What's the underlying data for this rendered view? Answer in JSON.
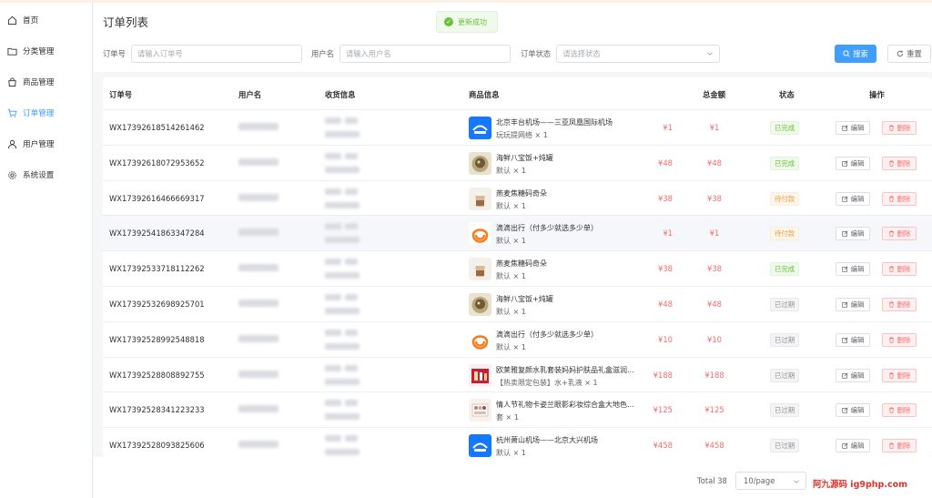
{
  "sidebar": {
    "items": [
      {
        "label": "首页",
        "icon": "home-icon",
        "active": false
      },
      {
        "label": "分类管理",
        "icon": "folder-icon",
        "active": false
      },
      {
        "label": "商品管理",
        "icon": "bag-icon",
        "active": false
      },
      {
        "label": "订单管理",
        "icon": "cart-icon",
        "active": true
      },
      {
        "label": "用户管理",
        "icon": "user-icon",
        "active": false
      },
      {
        "label": "系统设置",
        "icon": "gear-icon",
        "active": false
      }
    ]
  },
  "page": {
    "title": "订单列表"
  },
  "toast": {
    "message": "更新成功",
    "color": "#67c23a"
  },
  "filters": {
    "order_label": "订单号",
    "order_placeholder": "请输入订单号",
    "user_label": "用户名",
    "user_placeholder": "请输入用户名",
    "status_label": "订单状态",
    "status_placeholder": "请选择状态",
    "search_label": "搜索",
    "reset_label": "重置"
  },
  "table": {
    "headers": {
      "order": "订单号",
      "user": "用户名",
      "address": "收货信息",
      "product": "商品信息",
      "total": "总金额",
      "status": "状态",
      "action": "操作"
    },
    "edit_label": "编辑",
    "delete_label": "删除",
    "rows": [
      {
        "order": "WX17392618514261462",
        "product": "北京丰台机场——三亚凤凰国际机场",
        "qty": "玩玩提网络 × 1",
        "thumb": "blue-app",
        "unit": "¥1",
        "total": "¥1",
        "status": "已完成",
        "status_type": "done"
      },
      {
        "order": "WX17392618072953652",
        "product": "海鲜八宝饭+炖罐",
        "qty": "默认 × 1",
        "thumb": "food",
        "unit": "¥48",
        "total": "¥48",
        "status": "已完成",
        "status_type": "done"
      },
      {
        "order": "WX17392616466669317",
        "product": "燕麦焦糖码奇朵",
        "qty": "默认 × 1",
        "thumb": "coffee",
        "unit": "¥38",
        "total": "¥38",
        "status": "待付款",
        "status_type": "wait"
      },
      {
        "order": "WX17392541863347284",
        "product": "滴滴出行（付多少就选多少单）",
        "qty": "默认 × 1",
        "thumb": "didi",
        "unit": "¥1",
        "total": "¥1",
        "status": "待付款",
        "status_type": "wait"
      },
      {
        "order": "WX17392533718112262",
        "product": "燕麦焦糖码奇朵",
        "qty": "默认 × 1",
        "thumb": "coffee",
        "unit": "¥38",
        "total": "¥38",
        "status": "已完成",
        "status_type": "done"
      },
      {
        "order": "WX17392532698925701",
        "product": "海鲜八宝饭+炖罐",
        "qty": "默认 × 1",
        "thumb": "food",
        "unit": "¥48",
        "total": "¥48",
        "status": "已过期",
        "status_type": "exp"
      },
      {
        "order": "WX17392528992548818",
        "product": "滴滴出行（付多少就选多少单）",
        "qty": "默认 × 1",
        "thumb": "didi",
        "unit": "¥10",
        "total": "¥10",
        "status": "已过期",
        "status_type": "exp"
      },
      {
        "order": "WX17392528808892755",
        "product": "欧莱雅复颜水乳套装妈妈护肤品礼盒滋润...",
        "qty": "【热卖限定包装】水+乳液 × 1",
        "thumb": "cosmetic",
        "unit": "¥188",
        "total": "¥188",
        "status": "已过期",
        "status_type": "exp"
      },
      {
        "order": "WX17392528341223233",
        "product": "情人节礼物卡姿兰眼影彩妆综合盒大地色...",
        "qty": "套 × 1",
        "thumb": "makeup",
        "unit": "¥125",
        "total": "¥125",
        "status": "已过期",
        "status_type": "exp"
      },
      {
        "order": "WX17392528093825606",
        "product": "杭州萧山机场——北京大兴机场",
        "qty": "默认 × 1",
        "thumb": "blue-app",
        "unit": "¥458",
        "total": "¥458",
        "status": "已过期",
        "status_type": "exp"
      }
    ]
  },
  "pagination": {
    "total_text": "Total 38",
    "page_size": "10/page"
  },
  "watermark": "阿九源码 ig9php.com",
  "colors": {
    "primary": "#409eff",
    "danger": "#f56c6c",
    "success": "#67c23a",
    "warning": "#e6a23c"
  }
}
